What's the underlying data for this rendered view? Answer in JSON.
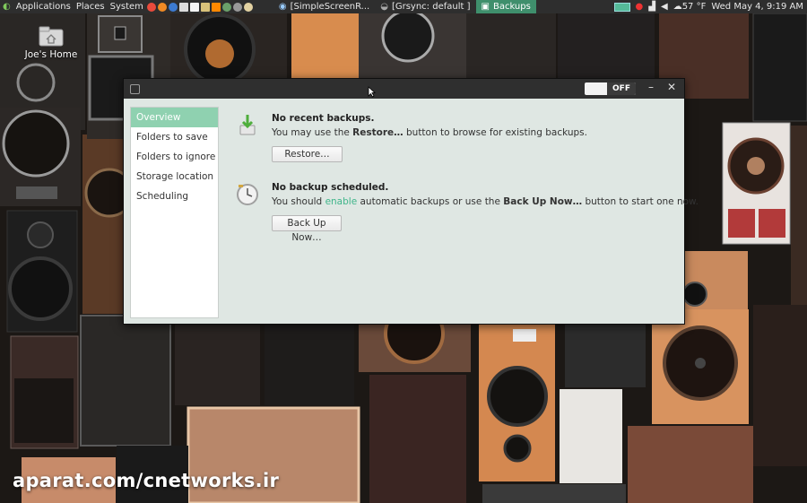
{
  "panel": {
    "menus": [
      "Applications",
      "Places",
      "System"
    ],
    "tasks": [
      {
        "label": "[SimpleScreenR...",
        "active": false
      },
      {
        "label": "[Grsync: default ]",
        "active": false
      },
      {
        "label": "Backups",
        "active": true
      }
    ],
    "weather": "57 °F",
    "clock": "Wed May 4,  9:19 AM"
  },
  "desktop": {
    "home_label": "Joe's Home",
    "watermark": "aparat.com/cnetworks.ir"
  },
  "window": {
    "toggle_label": "OFF",
    "minimize_glyph": "–",
    "close_glyph": "✕",
    "sidebar": [
      {
        "label": "Overview",
        "selected": true
      },
      {
        "label": "Folders to save",
        "selected": false
      },
      {
        "label": "Folders to ignore",
        "selected": false
      },
      {
        "label": "Storage location",
        "selected": false
      },
      {
        "label": "Scheduling",
        "selected": false
      }
    ],
    "restore_section": {
      "title": "No recent backups.",
      "desc_pre": "You may use the ",
      "desc_bold": "Restore…",
      "desc_post": " button to browse for existing backups.",
      "button": "Restore…"
    },
    "backup_section": {
      "title": "No backup scheduled.",
      "desc_pre": "You should ",
      "desc_link": "enable",
      "desc_mid": " automatic backups or use the ",
      "desc_bold": "Back Up Now…",
      "desc_post": " button to start one now.",
      "button": "Back Up Now…"
    }
  },
  "colors": {
    "accent": "#8fd1b0",
    "link": "#3fb58a",
    "panel": "#2e2e2e",
    "window_bg": "#dfe7e3"
  }
}
